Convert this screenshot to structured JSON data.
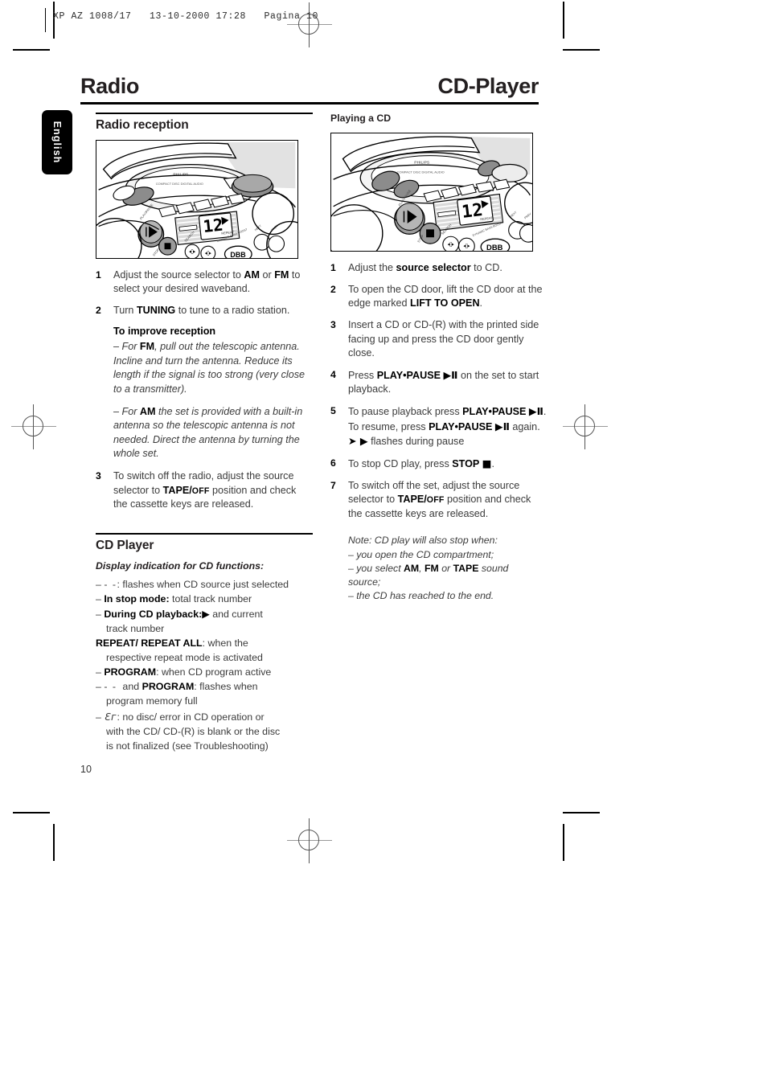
{
  "slug": {
    "text": "XP AZ 1008/17   13-10-2000 17:28   Pagina 10"
  },
  "language_tab": {
    "label": "English"
  },
  "page_titles": {
    "left": "Radio",
    "right": "CD-Player"
  },
  "page_number": "10",
  "left_column": {
    "section_title": "Radio reception",
    "illustration_name": "radio-cd-player-control-panel-illustration",
    "steps": [
      {
        "num": "1",
        "parts": [
          {
            "t": "Adjust the source selector to ",
            "b": false
          },
          {
            "t": "AM",
            "b": true
          },
          {
            "t": " or ",
            "b": false
          },
          {
            "t": "FM",
            "b": true
          },
          {
            "t": " to select your desired waveband.",
            "b": false
          }
        ]
      },
      {
        "num": "2",
        "parts": [
          {
            "t": "Turn ",
            "b": false
          },
          {
            "t": "TUNING",
            "b": true
          },
          {
            "t": " to tune to a radio station.",
            "b": false
          }
        ]
      }
    ],
    "improve_reception": {
      "heading": "To improve reception",
      "paragraphs": [
        [
          {
            "t": "– For ",
            "b": false
          },
          {
            "t": "FM",
            "b": true
          },
          {
            "t": ", pull out the telescopic antenna. Incline and turn the antenna. Reduce its length if the signal is too strong (very close to a transmitter).",
            "b": false
          }
        ],
        [
          {
            "t": "– For ",
            "b": false
          },
          {
            "t": "AM",
            "b": true
          },
          {
            "t": " the set is provided with a built-in antenna so the telescopic antenna is not needed. Direct the antenna by turning the whole set.",
            "b": false
          }
        ]
      ]
    },
    "step3": {
      "num": "3",
      "parts": [
        {
          "t": "To switch off the radio, adjust the source selector to ",
          "b": false
        },
        {
          "t": "TAPE/",
          "b": true
        },
        {
          "t": "OFF",
          "b": true,
          "sc": true
        },
        {
          "t": " position and check the cassette keys are released.",
          "b": false
        }
      ]
    },
    "cd_player": {
      "section_title": "CD Player",
      "display_heading": "Display indication for CD functions:",
      "items": [
        {
          "kind": "dash",
          "parts": [
            {
              "t": "– ",
              "b": false
            },
            {
              "t": "- -",
              "b": false,
              "dash": true
            },
            {
              "t": ": flashes when CD source just selected",
              "b": false
            }
          ]
        },
        {
          "kind": "dash",
          "parts": [
            {
              "t": "– ",
              "b": false
            },
            {
              "t": "In stop mode:",
              "b": true
            },
            {
              "t": " total track number",
              "b": false
            }
          ]
        },
        {
          "kind": "dash",
          "parts": [
            {
              "t": "– ",
              "b": false
            },
            {
              "t": "During CD playback:",
              "b": true
            },
            {
              "t": "▶",
              "b": true,
              "glyph": true
            },
            {
              "t": " and current",
              "b": false
            }
          ]
        },
        {
          "kind": "cont",
          "parts": [
            {
              "t": "track number",
              "b": false
            }
          ]
        },
        {
          "kind": "nodash",
          "parts": [
            {
              "t": "REPEAT/ REPEAT ALL",
              "b": true
            },
            {
              "t": ": when the",
              "b": false
            }
          ]
        },
        {
          "kind": "cont",
          "parts": [
            {
              "t": "respective repeat mode is activated",
              "b": false
            }
          ]
        },
        {
          "kind": "dash",
          "parts": [
            {
              "t": "– ",
              "b": false
            },
            {
              "t": "PROGRAM",
              "b": true
            },
            {
              "t": ": when CD program active",
              "b": false
            }
          ]
        },
        {
          "kind": "dash",
          "parts": [
            {
              "t": "– ",
              "b": false
            },
            {
              "t": "- -",
              "b": false,
              "dash": true
            },
            {
              "t": "  and ",
              "b": false
            },
            {
              "t": "PROGRAM",
              "b": true
            },
            {
              "t": ": flashes when",
              "b": false
            }
          ]
        },
        {
          "kind": "cont",
          "parts": [
            {
              "t": "program memory full",
              "b": false
            }
          ]
        },
        {
          "kind": "dash",
          "parts": [
            {
              "t": "– ",
              "b": false
            },
            {
              "t": "Ɛг",
              "b": false,
              "er": true
            },
            {
              "t": ": no disc/ error in CD operation or",
              "b": false
            }
          ]
        },
        {
          "kind": "cont",
          "parts": [
            {
              "t": "with the CD/ CD-(R) is blank or the disc",
              "b": false
            }
          ]
        },
        {
          "kind": "cont",
          "parts": [
            {
              "t": "is not finalized (see Troubleshooting)",
              "b": false
            }
          ]
        }
      ]
    }
  },
  "right_column": {
    "section_title": "Playing a CD",
    "illustration_name": "cd-player-control-panel-illustration",
    "steps": [
      {
        "num": "1",
        "parts": [
          {
            "t": "Adjust the ",
            "b": false
          },
          {
            "t": "source selector",
            "b": true
          },
          {
            "t": " to CD.",
            "b": false
          }
        ]
      },
      {
        "num": "2",
        "parts": [
          {
            "t": "To open the CD door, lift the CD door at the edge marked ",
            "b": false
          },
          {
            "t": "LIFT TO OPEN",
            "b": true
          },
          {
            "t": ".",
            "b": false
          }
        ]
      },
      {
        "num": "3",
        "parts": [
          {
            "t": "Insert a CD or CD-(R) with the printed side facing up and press the CD door gently close.",
            "b": false
          }
        ]
      },
      {
        "num": "4",
        "parts": [
          {
            "t": "Press ",
            "b": false
          },
          {
            "t": "PLAY•PAUSE",
            "b": true
          },
          {
            "t": " ▶Ⅱ",
            "b": true,
            "glyph": true
          },
          {
            "t": " on the set to start playback.",
            "b": false
          }
        ]
      },
      {
        "num": "5",
        "parts": [
          {
            "t": "To pause playback press ",
            "b": false
          },
          {
            "t": "PLAY•PAUSE",
            "b": true
          },
          {
            "t": " ▶Ⅱ",
            "b": true,
            "glyph": true
          },
          {
            "t": ". To resume, press ",
            "b": false
          },
          {
            "t": "PLAY•PAUSE",
            "b": true
          },
          {
            "t": " ▶Ⅱ",
            "b": true,
            "glyph": true
          },
          {
            "t": " again.",
            "b": false
          }
        ],
        "sub": [
          {
            "t": "➜",
            "b": true,
            "glyph": true
          },
          {
            "t": " ▶",
            "b": true,
            "glyph": true
          },
          {
            "t": " flashes during pause",
            "b": false
          }
        ]
      },
      {
        "num": "6",
        "parts": [
          {
            "t": "To stop CD play, press ",
            "b": false
          },
          {
            "t": "STOP",
            "b": true
          },
          {
            "t": " ■",
            "b": true,
            "glyph": true
          },
          {
            "t": ".",
            "b": false
          }
        ]
      },
      {
        "num": "7",
        "parts": [
          {
            "t": "To switch off the set, adjust the source selector to ",
            "b": false
          },
          {
            "t": "TAPE/",
            "b": true
          },
          {
            "t": "OFF",
            "b": true,
            "sc": true
          },
          {
            "t": " position and check the cassette keys are released.",
            "b": false
          }
        ]
      }
    ],
    "note": {
      "lines": [
        [
          {
            "t": "Note: CD play will also stop when:",
            "b": false
          }
        ],
        [
          {
            "t": "– you open the CD compartment;",
            "b": false
          }
        ],
        [
          {
            "t": "– you select ",
            "b": false
          },
          {
            "t": "AM",
            "b": true
          },
          {
            "t": ", ",
            "b": false
          },
          {
            "t": "FM",
            "b": true
          },
          {
            "t": " or ",
            "b": false
          },
          {
            "t": "TAPE",
            "b": true
          },
          {
            "t": " sound",
            "b": false
          }
        ],
        [
          {
            "t": "source;",
            "b": false
          }
        ],
        [
          {
            "t": "– the CD has reached to the end.",
            "b": false
          }
        ]
      ]
    }
  }
}
